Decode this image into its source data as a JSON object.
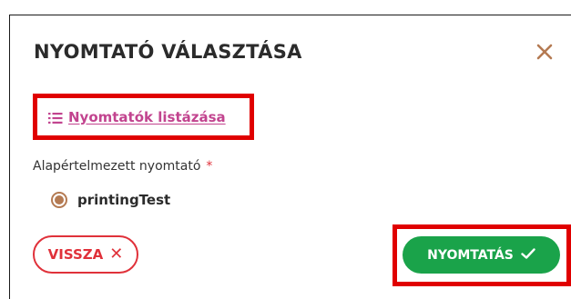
{
  "dialog": {
    "title": "NYOMTATÓ VÁLASZTÁSA",
    "close_icon": "close-icon"
  },
  "list_link": {
    "label": "Nyomtatók listázása",
    "icon": "list-icon"
  },
  "default_printer": {
    "label": "Alapértelmezett nyomtató",
    "required_mark": "*",
    "options": [
      {
        "label": "printingTest",
        "selected": true
      }
    ]
  },
  "actions": {
    "back_label": "VISSZA",
    "back_icon": "✕",
    "print_label": "NYOMTATÁS",
    "print_icon": "check-icon"
  },
  "colors": {
    "title": "#2b2b2b",
    "close": "#b47a52",
    "link": "#c2448f",
    "radio": "#b47a52",
    "required": "#e0313a",
    "back_button": "#e0313a",
    "print_button": "#1aa34a",
    "highlight_box": "#e00000"
  }
}
